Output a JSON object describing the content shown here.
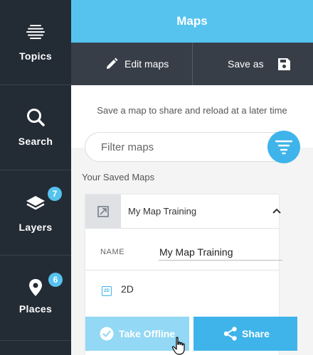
{
  "sidebar": {
    "items": [
      {
        "label": "Topics",
        "icon": "topics-icon"
      },
      {
        "label": "Search",
        "icon": "search-icon"
      },
      {
        "label": "Layers",
        "icon": "layers-icon",
        "badge": "7"
      },
      {
        "label": "Places",
        "icon": "place-pin-icon",
        "badge": "6"
      }
    ]
  },
  "header": {
    "title": "Maps"
  },
  "toolbar": {
    "edit_label": "Edit maps",
    "save_as_label": "Save as"
  },
  "panel": {
    "hint": "Save a map to share and reload at a later time",
    "filter_placeholder": "Filter maps",
    "saved_title": "Your Saved Maps"
  },
  "saved_map": {
    "title": "My Map Training",
    "name_label": "NAME",
    "name_value": "My Map Training",
    "mode_icon_text": "2D",
    "mode_label": "2D"
  },
  "actions": {
    "offline_label": "Take Offline",
    "share_label": "Share"
  },
  "colors": {
    "sidebar_bg": "#232b35",
    "accent": "#3fb4ea",
    "header_bg": "#55c3ee",
    "toolbar_bg": "#383e48",
    "offline_bg": "#93d8f4"
  }
}
